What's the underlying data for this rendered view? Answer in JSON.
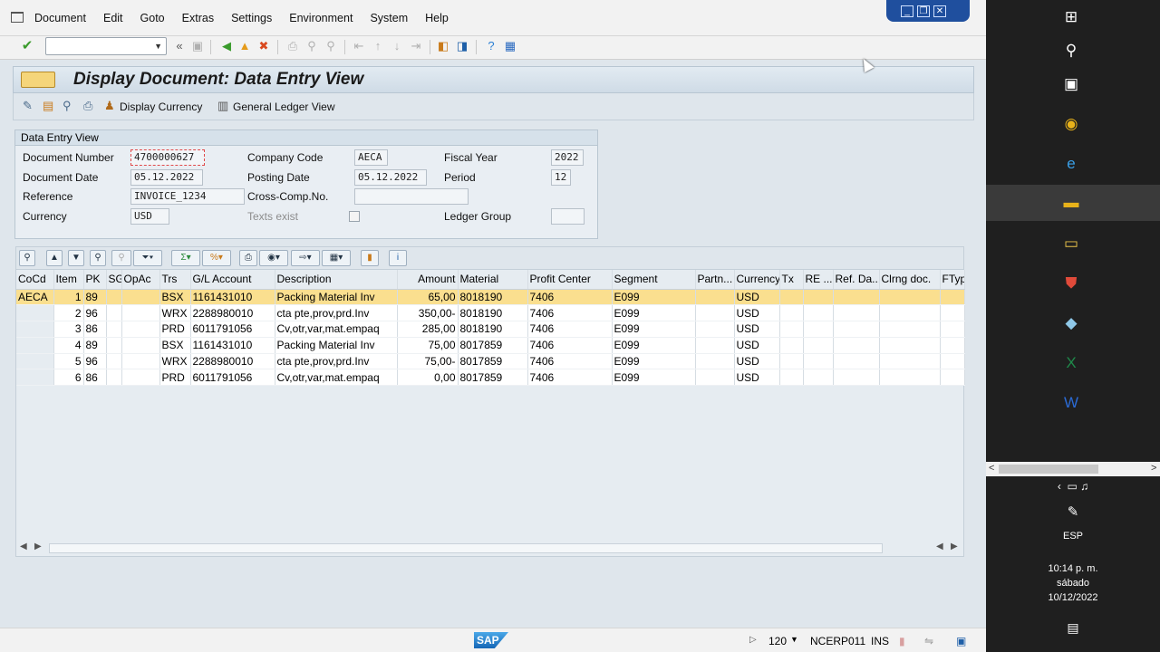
{
  "menu": {
    "items": [
      "Document",
      "Edit",
      "Goto",
      "Extras",
      "Settings",
      "Environment",
      "System",
      "Help"
    ]
  },
  "window_buttons": [
    "minimize",
    "restore",
    "close"
  ],
  "toolbar": {
    "command_field": "",
    "icons": [
      "enter-icon",
      "back-icon",
      "exit-icon",
      "cancel-icon",
      "print-icon",
      "find-icon",
      "find-next-icon",
      "first-page-icon",
      "prev-page-icon",
      "next-page-icon",
      "last-page-icon",
      "new-session-icon",
      "shortcut-icon",
      "help-icon",
      "customize-icon"
    ]
  },
  "page": {
    "title": "Display Document: Data Entry View",
    "app_toolbar": {
      "display_currency": "Display Currency",
      "general_ledger_view": "General Ledger View"
    }
  },
  "header": {
    "group_title": "Data Entry View",
    "document_number_label": "Document Number",
    "document_number": "4700000627",
    "company_code_label": "Company Code",
    "company_code": "AECA",
    "fiscal_year_label": "Fiscal Year",
    "fiscal_year": "2022",
    "document_date_label": "Document Date",
    "document_date": "05.12.2022",
    "posting_date_label": "Posting Date",
    "posting_date": "05.12.2022",
    "period_label": "Period",
    "period": "12",
    "reference_label": "Reference",
    "reference": "INVOICE_1234",
    "cross_comp_label": "Cross-Comp.No.",
    "cross_comp": "",
    "currency_label": "Currency",
    "currency": "USD",
    "texts_exist_label": "Texts exist",
    "texts_exist": false,
    "ledger_group_label": "Ledger Group",
    "ledger_group": ""
  },
  "grid": {
    "columns": [
      "CoCd",
      "Item",
      "PK",
      "SG",
      "OpAc",
      "Trs",
      "G/L Account",
      "Description",
      "Amount",
      "Material",
      "Profit Center",
      "Segment",
      "Partn...",
      "Currency",
      "Tx",
      "RE ...",
      "Ref. Da...",
      "Clrng doc.",
      "FTyp"
    ],
    "rows": [
      {
        "cocd": "AECA",
        "item": "1",
        "pk": "89",
        "sg": "",
        "opac": "",
        "trs": "BSX",
        "gl": "1161431010",
        "desc": "Packing Material Inv",
        "amount": "65,00",
        "material": "8018190",
        "pc": "7406",
        "segment": "E099",
        "partn": "",
        "currency": "USD"
      },
      {
        "cocd": "",
        "item": "2",
        "pk": "96",
        "sg": "",
        "opac": "",
        "trs": "WRX",
        "gl": "2288980010",
        "desc": "cta pte,prov,prd.Inv",
        "amount": "350,00-",
        "material": "8018190",
        "pc": "7406",
        "segment": "E099",
        "partn": "",
        "currency": "USD"
      },
      {
        "cocd": "",
        "item": "3",
        "pk": "86",
        "sg": "",
        "opac": "",
        "trs": "PRD",
        "gl": "6011791056",
        "desc": "Cv,otr,var,mat.empaq",
        "amount": "285,00",
        "material": "8018190",
        "pc": "7406",
        "segment": "E099",
        "partn": "",
        "currency": "USD"
      },
      {
        "cocd": "",
        "item": "4",
        "pk": "89",
        "sg": "",
        "opac": "",
        "trs": "BSX",
        "gl": "1161431010",
        "desc": "Packing Material Inv",
        "amount": "75,00",
        "material": "8017859",
        "pc": "7406",
        "segment": "E099",
        "partn": "",
        "currency": "USD"
      },
      {
        "cocd": "",
        "item": "5",
        "pk": "96",
        "sg": "",
        "opac": "",
        "trs": "WRX",
        "gl": "2288980010",
        "desc": "cta pte,prov,prd.Inv",
        "amount": "75,00-",
        "material": "8017859",
        "pc": "7406",
        "segment": "E099",
        "partn": "",
        "currency": "USD"
      },
      {
        "cocd": "",
        "item": "6",
        "pk": "86",
        "sg": "",
        "opac": "",
        "trs": "PRD",
        "gl": "6011791056",
        "desc": "Cv,otr,var,mat.empaq",
        "amount": "0,00",
        "material": "8017859",
        "pc": "7406",
        "segment": "E099",
        "partn": "",
        "currency": "USD"
      }
    ]
  },
  "status": {
    "client": "120",
    "system": "NCERP011",
    "mode": "INS",
    "logo": "SAP"
  },
  "taskbar": {
    "language": "ESP",
    "time": "10:14 p. m.",
    "day": "sábado",
    "date": "10/12/2022"
  }
}
